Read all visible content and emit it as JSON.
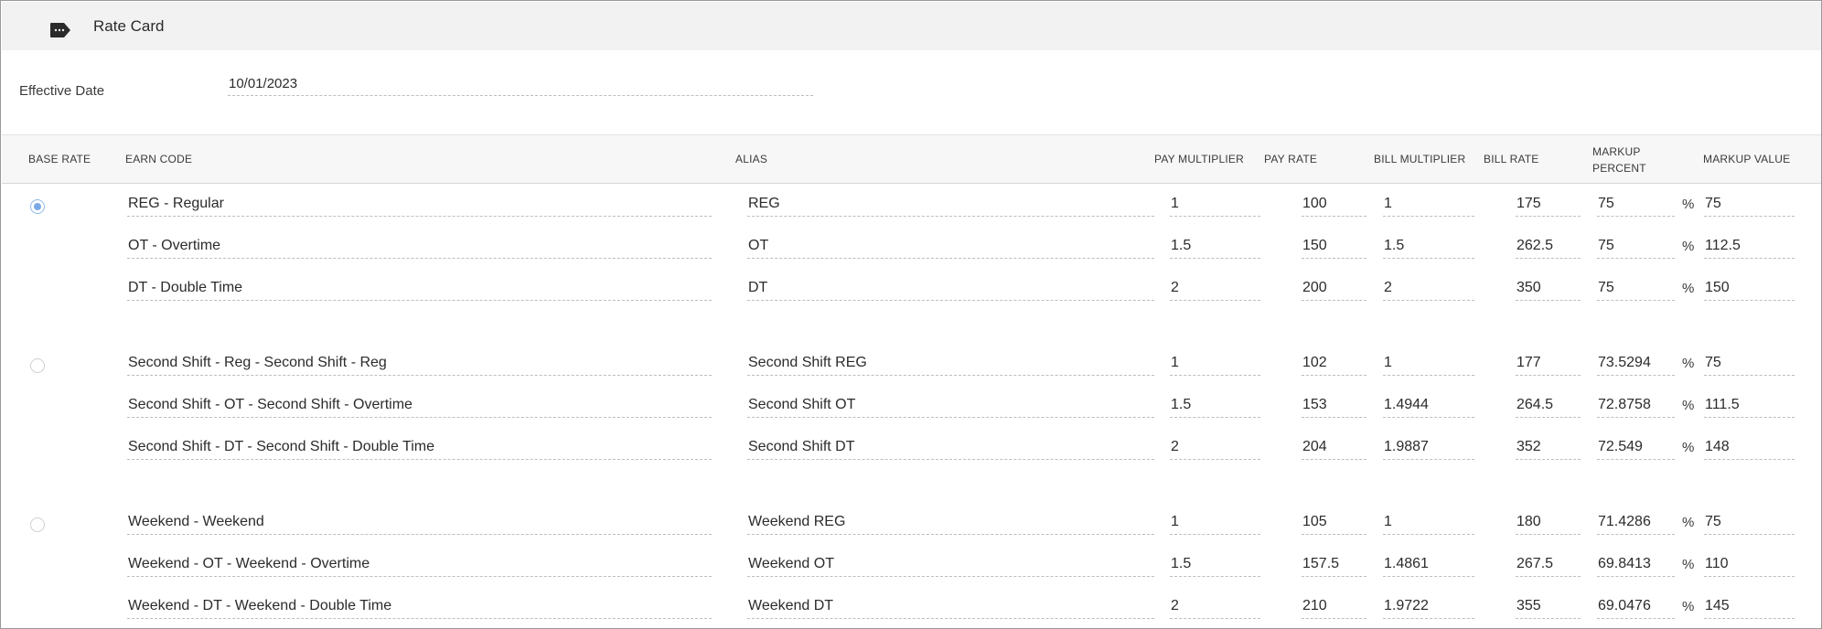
{
  "header": {
    "title": "Rate Card",
    "icon": "tag-icon"
  },
  "effective_date": {
    "label": "Effective Date",
    "value": "10/01/2023"
  },
  "columns": {
    "base_rate": "BASE RATE",
    "earn_code": "EARN CODE",
    "alias": "ALIAS",
    "pay_multiplier": "PAY MULTIPLIER",
    "pay_rate": "PAY RATE",
    "bill_multiplier": "BILL MULTIPLIER",
    "bill_rate": "BILL RATE",
    "markup_percent_line1": "MARKUP",
    "markup_percent_line2": "PERCENT",
    "markup_value": "MARKUP VALUE"
  },
  "percent_symbol": "%",
  "groups": [
    {
      "base_rate_selected": true,
      "rows": [
        {
          "earn_code": "REG - Regular",
          "alias": "REG",
          "pay_multiplier": "1",
          "pay_rate": "100",
          "bill_multiplier": "1",
          "bill_rate": "175",
          "markup_percent": "75",
          "markup_value": "75"
        },
        {
          "earn_code": "OT - Overtime",
          "alias": "OT",
          "pay_multiplier": "1.5",
          "pay_rate": "150",
          "bill_multiplier": "1.5",
          "bill_rate": "262.5",
          "markup_percent": "75",
          "markup_value": "112.5"
        },
        {
          "earn_code": "DT - Double Time",
          "alias": "DT",
          "pay_multiplier": "2",
          "pay_rate": "200",
          "bill_multiplier": "2",
          "bill_rate": "350",
          "markup_percent": "75",
          "markup_value": "150"
        }
      ]
    },
    {
      "base_rate_selected": false,
      "rows": [
        {
          "earn_code": "Second Shift - Reg - Second Shift - Reg",
          "alias": "Second Shift REG",
          "pay_multiplier": "1",
          "pay_rate": "102",
          "bill_multiplier": "1",
          "bill_rate": "177",
          "markup_percent": "73.5294",
          "markup_value": "75"
        },
        {
          "earn_code": "Second Shift - OT - Second Shift - Overtime",
          "alias": "Second Shift OT",
          "pay_multiplier": "1.5",
          "pay_rate": "153",
          "bill_multiplier": "1.4944",
          "bill_rate": "264.5",
          "markup_percent": "72.8758",
          "markup_value": "111.5"
        },
        {
          "earn_code": "Second Shift - DT - Second Shift - Double Time",
          "alias": "Second Shift DT",
          "pay_multiplier": "2",
          "pay_rate": "204",
          "bill_multiplier": "1.9887",
          "bill_rate": "352",
          "markup_percent": "72.549",
          "markup_value": "148"
        }
      ]
    },
    {
      "base_rate_selected": false,
      "rows": [
        {
          "earn_code": "Weekend - Weekend",
          "alias": "Weekend REG",
          "pay_multiplier": "1",
          "pay_rate": "105",
          "bill_multiplier": "1",
          "bill_rate": "180",
          "markup_percent": "71.4286",
          "markup_value": "75"
        },
        {
          "earn_code": "Weekend - OT - Weekend - Overtime",
          "alias": "Weekend OT",
          "pay_multiplier": "1.5",
          "pay_rate": "157.5",
          "bill_multiplier": "1.4861",
          "bill_rate": "267.5",
          "markup_percent": "69.8413",
          "markup_value": "110"
        },
        {
          "earn_code": "Weekend - DT - Weekend - Double Time",
          "alias": "Weekend DT",
          "pay_multiplier": "2",
          "pay_rate": "210",
          "bill_multiplier": "1.9722",
          "bill_rate": "355",
          "markup_percent": "69.0476",
          "markup_value": "145"
        }
      ]
    }
  ]
}
